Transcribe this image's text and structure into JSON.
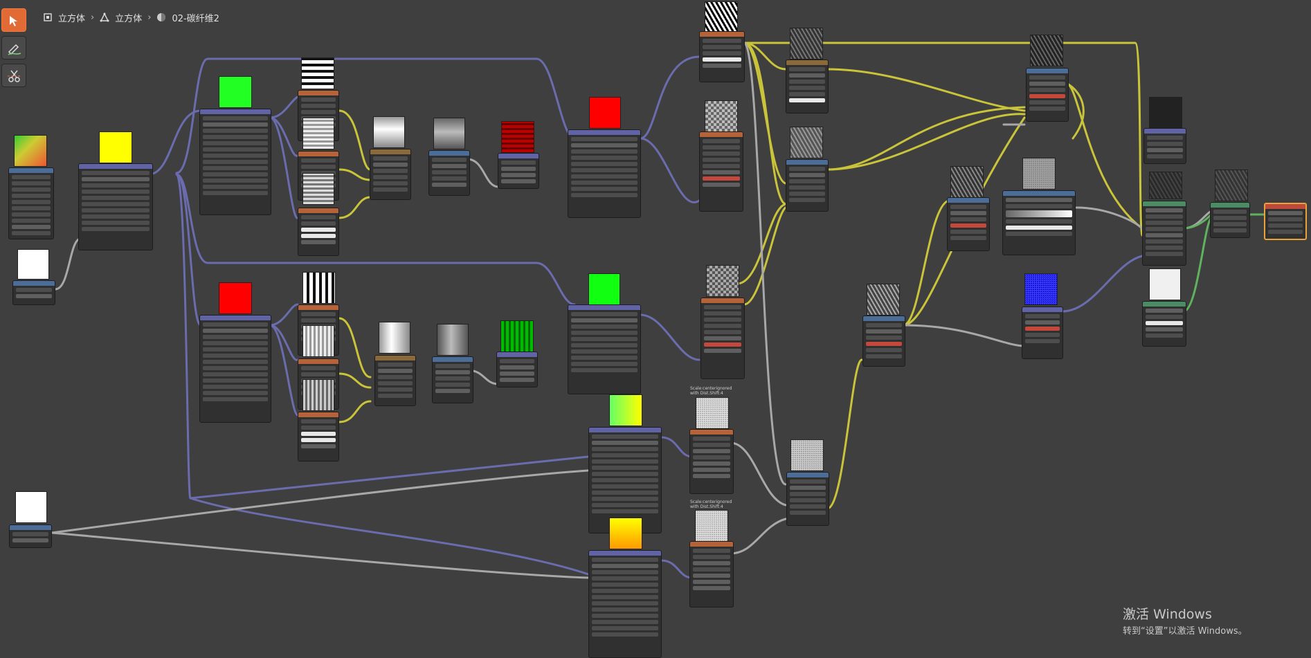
{
  "breadcrumb": {
    "items": [
      "立方体",
      "立方体",
      "02-碳纤维2"
    ]
  },
  "toolbar": {
    "tools": [
      "select-tool",
      "annotate-tool",
      "cut-links-tool"
    ]
  },
  "labels": {
    "scale_note_1": "Scale:centerignored\nwith Dist.Shift:4",
    "scale_note_2": "Scale:centerignored\nwith Dist.Shift:4"
  },
  "watermark": {
    "title": "激活 Windows",
    "subtitle": "转到“设置”以激活 Windows。"
  },
  "colors": {
    "background": "#3f3f3f",
    "vector_wire": "#6b6cae",
    "color_wire": "#c9c43a",
    "float_wire": "#a8a8a8",
    "shader_wire": "#5fb35f",
    "active_tool": "#e26a34"
  }
}
